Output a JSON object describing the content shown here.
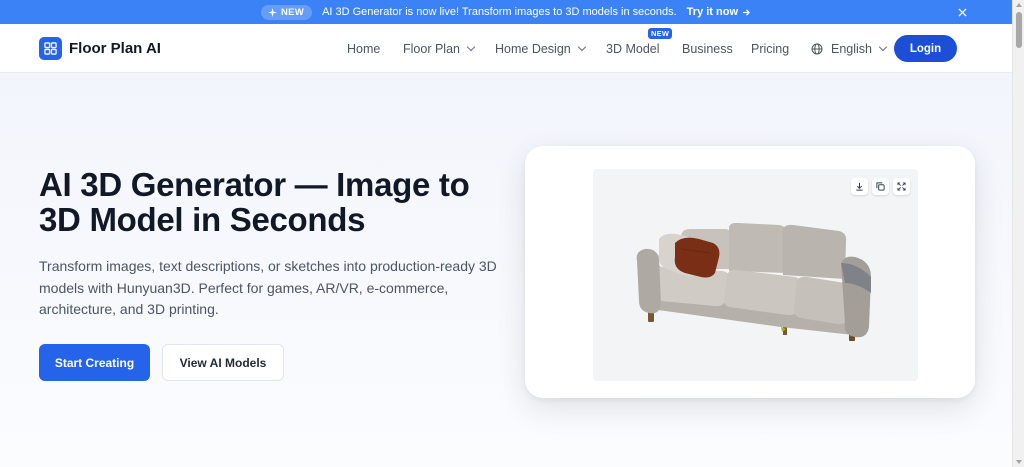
{
  "banner": {
    "badge": "NEW",
    "badge_icon": "sparkle-icon",
    "message": "AI 3D Generator is now live! Transform images to 3D models in seconds.",
    "cta": "Try it now",
    "cta_icon": "arrow-right-icon",
    "close_icon": "close-icon"
  },
  "nav": {
    "brand": "Floor Plan AI",
    "logo_icon": "grid-logo-icon",
    "links": {
      "home": "Home",
      "floor_plan": "Floor Plan",
      "home_design": "Home Design",
      "model_3d": "3D Model",
      "model_3d_badge": "NEW",
      "business": "Business",
      "pricing": "Pricing",
      "language": "English"
    },
    "login": "Login"
  },
  "hero": {
    "title": "AI 3D Generator — Image to 3D Model in Seconds",
    "description": "Transform images, text descriptions, or sketches into production-ready 3D models with Hunyuan3D. Perfect for games, AR/VR, e-commerce, architecture, and 3D printing.",
    "primary_button": "Start Creating",
    "secondary_button": "View AI Models"
  },
  "preview": {
    "toolbar_icons": [
      "download-icon",
      "copy-icon",
      "fullscreen-icon"
    ],
    "model_subject": "sofa-3d-model"
  },
  "colors": {
    "accent": "#2563eb",
    "banner": "#3b82f6",
    "headline": "#111827"
  }
}
